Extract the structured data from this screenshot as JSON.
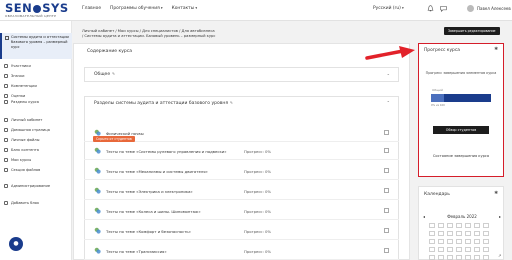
{
  "logo": {
    "main_left": "SEN",
    "main_right": "SYS",
    "sub": "ОБРАЗОВАТЕЛЬНЫЙ ЦЕНТР"
  },
  "topnav": {
    "home": "Главное",
    "programs": "Программы обучения",
    "contacts": "Контакты"
  },
  "lang": "Русский (ru)",
  "user": "Павел Алексеев",
  "edit_mode": "Завершить редактирование",
  "sidebar": {
    "course": "Системы аудита и аттестации базового уровня – размерный курс",
    "items": [
      "Участники",
      "Значки",
      "Компетенции",
      "Оценки",
      "Разделы курса",
      "Личный кабинет",
      "Домашняя страница",
      "Личные файлы",
      "Банк контента",
      "Мои курсы",
      "Секция файлов",
      "Администрирование",
      "Добавить блок"
    ]
  },
  "breadcrumb": {
    "line1": "Личный кабинет / Мои курсы / Для специалистов / Для автобизнеса",
    "line2": "/ Системы аудита и аттестации. Базовый уровень – размерный курс"
  },
  "main": {
    "toc": "Содержание курса",
    "section1": "Общее",
    "section2": "Разделы системы аудита и аттестации базового уровня",
    "first_activity": "Физический почвы",
    "badge": "Скрыто от студентов",
    "activities": [
      {
        "name": "Тесты по теме «Системы рулевого управления и подвески»",
        "progress": "Прогресс: 0%"
      },
      {
        "name": "Тесты по теме «Механизмы и системы двигателя»",
        "progress": "Прогресс: 0%"
      },
      {
        "name": "Тесты по теме «Электрика и электроника»",
        "progress": "Прогресс: 0%"
      },
      {
        "name": "Тесты по теме «Колеса и шины. Шиномонтаж»",
        "progress": "Прогресс: 0%"
      },
      {
        "name": "Тесты по теме «Комфорт и безопасность»",
        "progress": "Прогресс: 0%"
      },
      {
        "name": "Тесты по теме «Трансмиссия»",
        "progress": "Прогресс: 0%"
      }
    ]
  },
  "progress_block": {
    "title": "Прогресс курса",
    "text": "Прогресс завершения элементов курса",
    "mini_label": "Общий",
    "note": "0% из 100",
    "button": "Обзор студентов",
    "bottom": "Состояние завершения курса",
    "value": 0.22
  },
  "calendar": {
    "title": "Календарь",
    "month": "Февраль 2022",
    "prev": "◂",
    "next": "▸"
  },
  "icons": {
    "home": "menu-icon",
    "bell": "bell-icon",
    "chat": "chat-icon",
    "gear": "gear-icon",
    "pencil": "pencil-icon",
    "quiz": "quiz-icon",
    "checkbox": "checkbox-icon"
  },
  "colors": {
    "brand": "#1a3c8c",
    "accent": "#d51d2a",
    "badge": "#e8683a"
  }
}
